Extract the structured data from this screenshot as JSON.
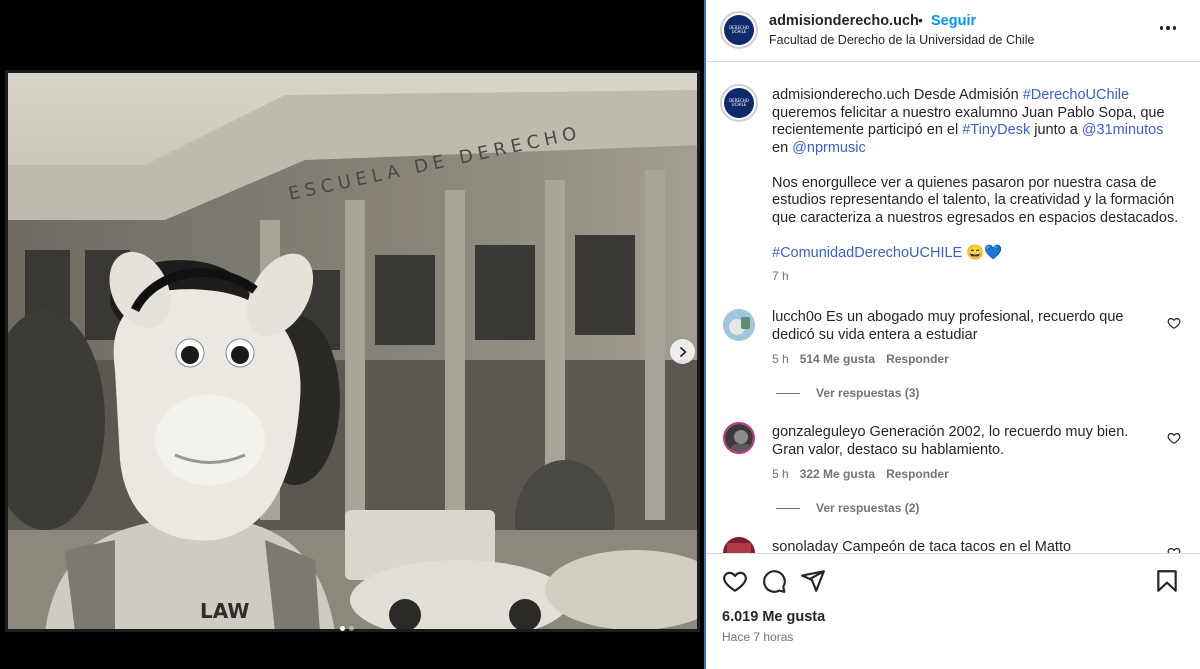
{
  "post": {
    "username": "admisionderecho.uch",
    "follow_label": "Seguir",
    "separator": "•",
    "subtitle": "Facultad de Derecho de la Universidad de Chile",
    "avatar_text": "DERECHO UCHILE",
    "caption": {
      "username": "admisionderecho.uch",
      "text_1": " Desde Admisión ",
      "tag_1": "#DerechoUChile",
      "text_2": " queremos felicitar a nuestro exalumno Juan Pablo Sopa, que recientemente participó en el ",
      "tag_2": "#TinyDesk",
      "text_3": " junto a ",
      "mention_1": "@31minutos",
      "text_4": " en ",
      "mention_2": "@nprmusic",
      "paragraph_2": "Nos enorgullece ver a quienes pasaron por nuestra casa de estudios representando el talento, la creatividad y la formación que caracteriza a nuestros egresados en espacios destacados.",
      "tag_3": "#ComunidadDerechoUCHILE",
      "emoji": "😄💙",
      "time": "7 h"
    },
    "photo_sign_text": "ESCUELA DE DERECHO",
    "photo_shirt_text": "LAW"
  },
  "comments": [
    {
      "username": "lucch0o",
      "text": " Es un abogado muy profesional, recuerdo que dedicó su vida entera a estudiar",
      "time": "5 h",
      "likes": "514 Me gusta",
      "reply_label": "Responder",
      "view_replies": "Ver respuestas (3)"
    },
    {
      "username": "gonzaleguleyo",
      "text": " Generación 2002, lo recuerdo muy bien. Gran valor, destaco su hablamiento.",
      "time": "5 h",
      "likes": "322 Me gusta",
      "reply_label": "Responder",
      "view_replies": "Ver respuestas (2)"
    },
    {
      "username": "sonoladay",
      "text": " Campeón de taca tacos en el Matto"
    }
  ],
  "footer": {
    "likes": "6.019 Me gusta",
    "posted": "Hace 7 horas"
  },
  "carousel": {
    "current": 1,
    "total": 2
  },
  "colors": {
    "link": "#3a5fd4",
    "follow": "#0095f6",
    "panel_border": "#3b6fd8",
    "avatar_navy": "#0e2a6b"
  },
  "icons": [
    "chevron-right-icon",
    "more-icon",
    "heart-icon",
    "comment-icon",
    "share-icon",
    "bookmark-icon"
  ]
}
